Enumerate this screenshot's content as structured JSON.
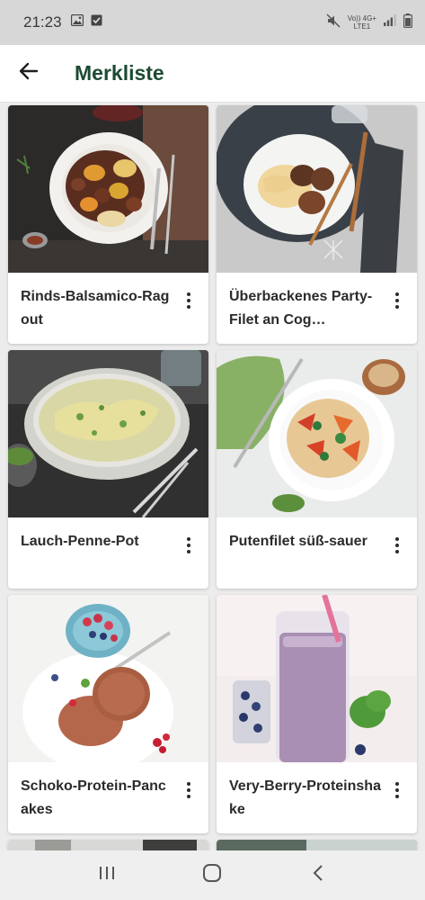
{
  "status_bar": {
    "time": "21:23",
    "network_line1": "Vo)) 4G+",
    "network_line2": "LTE1"
  },
  "app_bar": {
    "title": "Merkliste"
  },
  "recipes": [
    {
      "title": "Rinds-Balsamico-Ragout"
    },
    {
      "title": "Überbackenes Party-Filet an Cog…"
    },
    {
      "title": "Lauch-Penne-Pot"
    },
    {
      "title": "Putenfilet süß-sauer"
    },
    {
      "title": "Schoko-Protein-Pancakes"
    },
    {
      "title": "Very-Berry-Proteinshake"
    }
  ],
  "icons": {
    "back": "arrow-left-icon",
    "more": "more-vert-icon",
    "nav_recents": "recents-icon",
    "nav_home": "home-icon",
    "nav_back": "back-chevron-icon"
  },
  "colors": {
    "title_green": "#1d4a33",
    "status_bg": "#d7d7d7"
  }
}
